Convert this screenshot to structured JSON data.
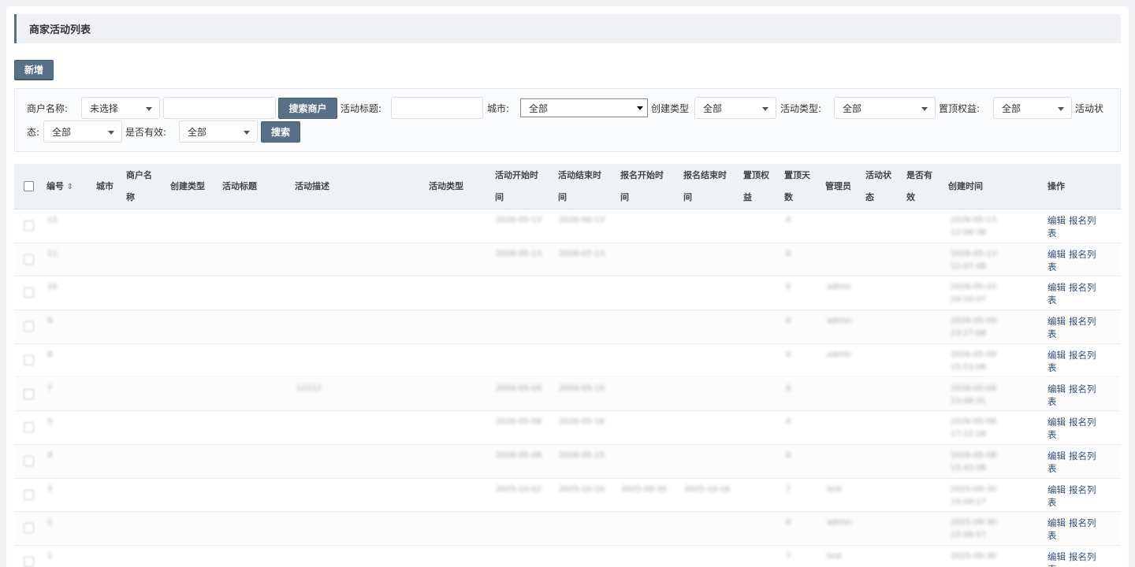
{
  "page": {
    "title": "商家活动列表"
  },
  "toolbar": {
    "add_label": "新增"
  },
  "filters": {
    "merchant_name_label": "商户名称:",
    "merchant_select": "未选择",
    "search_merchant_label": "搜索商户",
    "activity_title_label": "活动标题:",
    "city_label": "城市:",
    "city_select": "全部",
    "create_type_label": "创建类型",
    "create_type_select": "全部",
    "activity_type_label": "活动类型:",
    "activity_type_select": "全部",
    "top_rights_label": "置顶权益:",
    "top_rights_select": "全部",
    "activity_status_label_1": "活动状",
    "activity_status_label_2": "态:",
    "activity_status_select": "全部",
    "valid_label": "是否有效:",
    "valid_select": "全部",
    "search_label": "搜索"
  },
  "table": {
    "headers": {
      "id": "编号",
      "city": "城市",
      "merchant_1": "商户名",
      "merchant_2": "称",
      "create_type": "创建类型",
      "title": "活动标题",
      "desc": "活动描述",
      "type": "活动类型",
      "start_1": "活动开始时",
      "start_2": "间",
      "end_1": "活动结束时",
      "end_2": "间",
      "reg_start_1": "报名开始时",
      "reg_start_2": "间",
      "reg_end_1": "报名结束时",
      "reg_end_2": "间",
      "top_1": "置顶权",
      "top_2": "益",
      "top_days_1": "置顶天",
      "top_days_2": "数",
      "admin": "管理员",
      "status_1": "活动状",
      "status_2": "态",
      "valid_1": "是否有",
      "valid_2": "效",
      "created": "创建时间",
      "ops": "操作"
    },
    "op_edit": "编辑",
    "op_signups_1": "报名列",
    "op_signups_2": "表",
    "rows": [
      {
        "id": "12",
        "city": "",
        "merchant": "",
        "ctype": "",
        "title": "",
        "desc": "",
        "type": "",
        "start": "2026-05-13",
        "end": "2026-06-13",
        "rstart": "",
        "rend": "",
        "top": "",
        "days": "0",
        "admin": "",
        "status": "",
        "valid": "",
        "created": "2026-05-13 12:08:38"
      },
      {
        "id": "11",
        "city": "",
        "merchant": "",
        "ctype": "",
        "title": "",
        "desc": "",
        "type": "",
        "start": "2026-05-13",
        "end": "2026-07-13",
        "rstart": "",
        "rend": "",
        "top": "",
        "days": "0",
        "admin": "",
        "status": "",
        "valid": "",
        "created": "2026-05-13 12:07:48"
      },
      {
        "id": "10",
        "city": "",
        "merchant": "",
        "ctype": "",
        "title": "",
        "desc": "",
        "type": "",
        "start": "",
        "end": "",
        "rstart": "",
        "rend": "",
        "top": "",
        "days": "0",
        "admin": "admin",
        "status": "",
        "valid": "",
        "created": "2026-05-10 20:10:07"
      },
      {
        "id": "9",
        "city": "",
        "merchant": "",
        "ctype": "",
        "title": "",
        "desc": "",
        "type": "",
        "start": "",
        "end": "",
        "rstart": "",
        "rend": "",
        "top": "",
        "days": "0",
        "admin": "admin",
        "status": "",
        "valid": "",
        "created": "2026-05-09 23:27:08"
      },
      {
        "id": "8",
        "city": "",
        "merchant": "",
        "ctype": "",
        "title": "",
        "desc": "",
        "type": "",
        "start": "",
        "end": "",
        "rstart": "",
        "rend": "",
        "top": "",
        "days": "0",
        "admin": "admin",
        "status": "",
        "valid": "",
        "created": "2026-05-09 15:53:08"
      },
      {
        "id": "7",
        "city": "",
        "merchant": "",
        "ctype": "",
        "title": "",
        "desc": "12212",
        "type": "",
        "start": "2026-05-08",
        "end": "2026-05-15",
        "rstart": "",
        "rend": "",
        "top": "",
        "days": "0",
        "admin": "",
        "status": "",
        "valid": "",
        "created": "2026-05-08 23:48:31"
      },
      {
        "id": "5",
        "city": "",
        "merchant": "",
        "ctype": "",
        "title": "",
        "desc": "",
        "type": "",
        "start": "2026-05-08",
        "end": "2026-05-16",
        "rstart": "",
        "rend": "",
        "top": "",
        "days": "0",
        "admin": "",
        "status": "",
        "valid": "",
        "created": "2026-05-08 17:12:28"
      },
      {
        "id": "4",
        "city": "",
        "merchant": "",
        "ctype": "",
        "title": "",
        "desc": "",
        "type": "",
        "start": "2026-05-08",
        "end": "2026-05-15",
        "rstart": "",
        "rend": "",
        "top": "",
        "days": "0",
        "admin": "",
        "status": "",
        "valid": "",
        "created": "2026-05-08 15:43:08"
      },
      {
        "id": "3",
        "city": "",
        "merchant": "",
        "ctype": "",
        "title": "",
        "desc": "",
        "type": "",
        "start": "2025-10-02",
        "end": "2025-10-16",
        "rstart": "2025-09-30",
        "rend": "2025-10-16",
        "top": "",
        "days": "7",
        "admin": "test",
        "status": "",
        "valid": "",
        "created": "2025-09-30 15:48:17"
      },
      {
        "id": "2",
        "city": "",
        "merchant": "",
        "ctype": "",
        "title": "",
        "desc": "",
        "type": "",
        "start": "",
        "end": "",
        "rstart": "",
        "rend": "",
        "top": "",
        "days": "0",
        "admin": "admin",
        "status": "",
        "valid": "",
        "created": "2025-09-30 15:09:57"
      },
      {
        "id": "1",
        "city": "",
        "merchant": "",
        "ctype": "",
        "title": "",
        "desc": "",
        "type": "",
        "start": "",
        "end": "",
        "rstart": "",
        "rend": "",
        "top": "",
        "days": "7",
        "admin": "test",
        "status": "",
        "valid": "",
        "created": "2025-09-30"
      }
    ]
  },
  "colors": {
    "accent": "#5a7088",
    "link": "#2f4f75",
    "header_bg": "#eff2f5"
  }
}
